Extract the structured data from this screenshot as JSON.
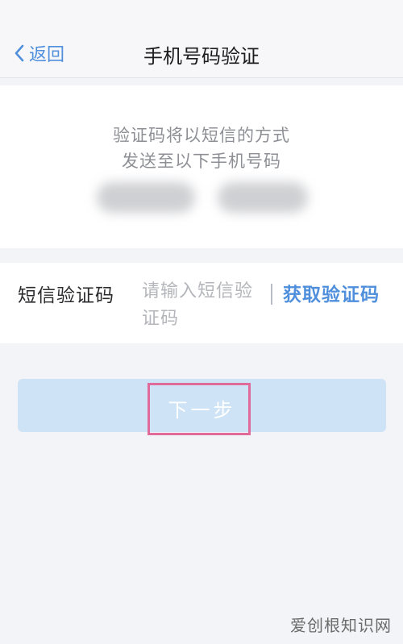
{
  "nav": {
    "back_label": "返回",
    "title": "手机号码验证"
  },
  "info": {
    "line1": "验证码将以短信的方式",
    "line2": "发送至以下手机号码"
  },
  "sms": {
    "label": "短信验证码",
    "placeholder": "请输入短信验证码",
    "get_code_label": "获取验证码"
  },
  "next_button": {
    "label": "下一步"
  },
  "watermark": "爱创根知识网",
  "colors": {
    "accent": "#4f8fdc",
    "button_disabled": "#cfe3f7",
    "highlight": "#e06b9a",
    "background": "#f3f4f8"
  }
}
